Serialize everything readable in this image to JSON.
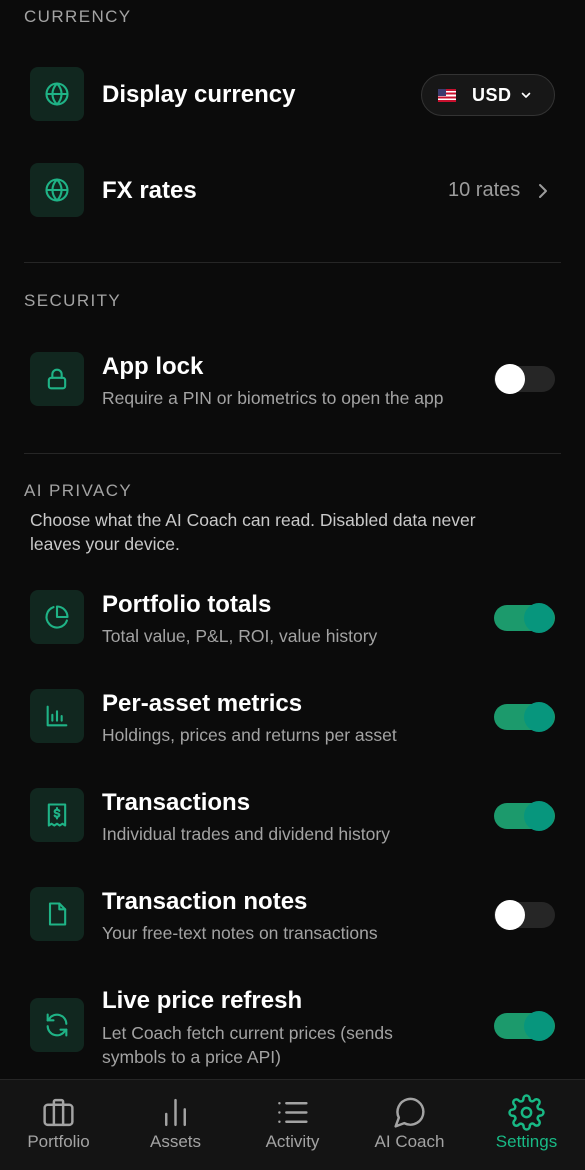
{
  "sections": {
    "currency": "CURRENCY",
    "security": "SECURITY",
    "ai_privacy": "AI PRIVACY"
  },
  "currency": {
    "display_label": "Display currency",
    "selected_currency": "USD",
    "fx_label": "FX rates",
    "fx_value": "10 rates"
  },
  "security": {
    "app_lock_title": "App lock",
    "app_lock_sub": "Require a PIN or biometrics to open the app",
    "app_lock_enabled": false
  },
  "ai_privacy": {
    "description_line1": "Choose what the AI Coach can read. Disabled data never",
    "description_line2": "leaves your device.",
    "items": [
      {
        "title": "Portfolio totals",
        "sub": [
          "Total value, P&L, ROI, value history"
        ],
        "enabled": true,
        "icon": "pie-chart-icon"
      },
      {
        "title": "Per-asset metrics",
        "sub": [
          "Holdings, prices and returns per asset"
        ],
        "enabled": true,
        "icon": "bar-chart-icon"
      },
      {
        "title": "Transactions",
        "sub": [
          "Individual trades and dividend history"
        ],
        "enabled": true,
        "icon": "receipt-icon"
      },
      {
        "title": "Transaction notes",
        "sub": [
          "Your free-text notes on transactions"
        ],
        "enabled": false,
        "icon": "note-icon"
      },
      {
        "title": "Live price refresh",
        "sub": [
          "Let Coach fetch current prices (sends",
          "symbols to a price API)"
        ],
        "enabled": true,
        "icon": "refresh-icon"
      }
    ]
  },
  "tabs": [
    {
      "label": "Portfolio",
      "icon": "briefcase-icon",
      "active": false
    },
    {
      "label": "Assets",
      "icon": "bar-chart-icon",
      "active": false
    },
    {
      "label": "Activity",
      "icon": "list-icon",
      "active": false
    },
    {
      "label": "AI Coach",
      "icon": "chat-bubble-icon",
      "active": false
    },
    {
      "label": "Settings",
      "icon": "gear-icon",
      "active": true
    }
  ],
  "colors": {
    "accent": "#18b985",
    "background": "#0b0b0b",
    "tile": "#11271f",
    "toggle_on": "#1c9a6c",
    "muted_text": "#a3a3a3"
  }
}
